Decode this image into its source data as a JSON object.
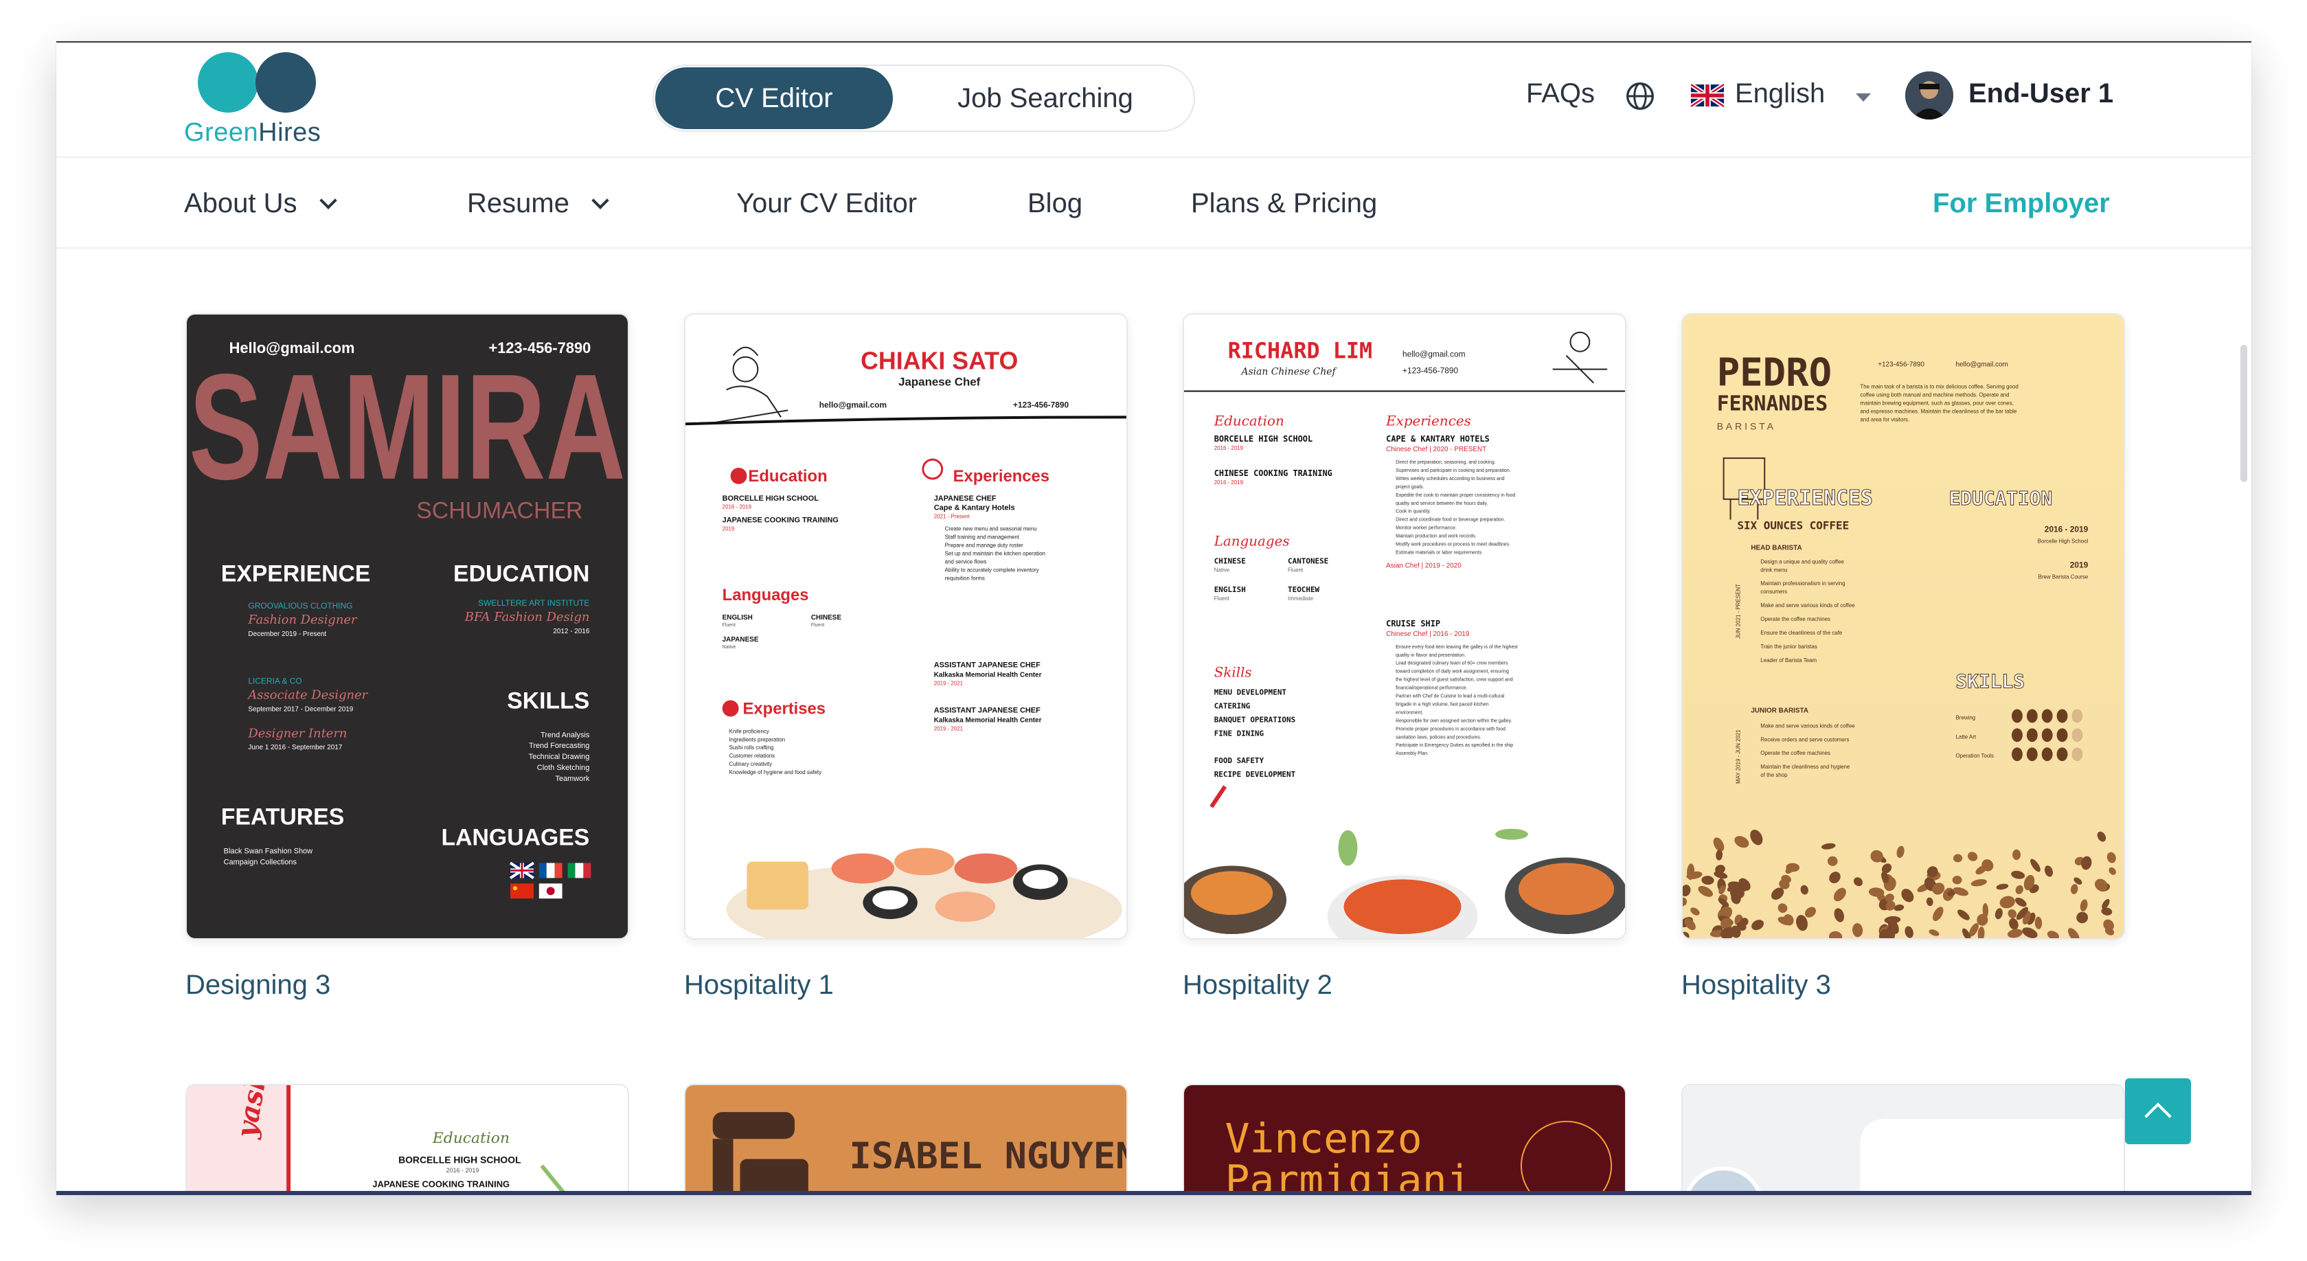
{
  "brand": {
    "part1": "Green",
    "part2": "Hires"
  },
  "header": {
    "modes": [
      "CV Editor",
      "Job Searching"
    ],
    "faq": "FAQs",
    "language": "English",
    "user": "End-User 1"
  },
  "nav": [
    "About Us",
    "Resume",
    "Your CV Editor",
    "Blog",
    "Plans & Pricing",
    "For Employer"
  ],
  "colors": {
    "teal": "#20aeb5",
    "navy": "#28536b",
    "red": "#d7262f"
  },
  "templates": [
    {
      "caption": "Designing 3",
      "email": "Hello@gmail.com",
      "phone": "+123-456-7890",
      "name": "SAMIRA",
      "surname": "SCHUMACHER",
      "h_experience": "EXPERIENCE",
      "h_education": "EDUCATION",
      "h_skills": "SKILLS",
      "h_features": "FEATURES",
      "h_languages": "LANGUAGES",
      "exp1": "GROOVALIOUS CLOTHING",
      "exp1_role": "Fashion Designer",
      "exp1_date": "December 2019 - Present",
      "exp2": "LICERIA & CO",
      "exp2_role": "Associate Designer",
      "exp2_date": "September 2017 - December 2019",
      "exp3_role": "Designer Intern",
      "exp3_date": "June 1 2016 - September 2017",
      "edu1": "SWELLTERE ART INSTITUTE",
      "edu1_deg": "BFA Fashion Design",
      "edu1_date": "2012 - 2016",
      "skills": [
        "Trend Analysis",
        "Trend Forecasting",
        "Technical Drawing",
        "Cloth Sketching",
        "Teamwork"
      ],
      "features": [
        "Black Swan Fashion Show",
        "Campaign Collections"
      ]
    },
    {
      "caption": "Hospitality 1",
      "name": "CHIAKI SATO",
      "title": "Japanese Chef",
      "email": "hello@gmail.com",
      "phone": "+123-456-7890",
      "h_education": "Education",
      "h_experiences": "Experiences",
      "h_languages": "Languages",
      "h_expertises": "Expertises",
      "edu1": "BORCELLE HIGH SCHOOL",
      "edu1_date": "2016 - 2019",
      "edu2": "JAPANESE COOKING TRAINING",
      "edu2_date": "2019",
      "exp_title": "JAPANESE CHEF",
      "exp_place": "Cape & Kantary Hotels",
      "exp_date": "2021 - Present",
      "exp_items": [
        "Create new menu and seasonal menu",
        "Staff training and management",
        "Prepare and manage duty roster",
        "Set up and maintain the kitchen operation",
        "and service flows",
        "Ability to accurately complete inventory",
        "requisition forms"
      ],
      "langs": [
        "ENGLISH",
        "CHINESE",
        "JAPANESE"
      ],
      "lang_levels": [
        "Fluent",
        "Fluent",
        "Native"
      ],
      "exp2_title": "ASSISTANT JAPANESE CHEF",
      "exp2_place": "Kalkaska Memorial Health Center",
      "exp2_date": "2019 - 2021",
      "exp3_title": "ASSISTANT JAPANESE CHEF",
      "exp3_place": "Kalkaska Memorial Health Center",
      "exp3_date": "2019 - 2021",
      "expertises": [
        "Knife proficiency",
        "Ingredients preparation",
        "Sushi rolls crafting",
        "Customer relations",
        "Culinary creativity",
        "Knowledge of hygiene and food safety"
      ]
    },
    {
      "caption": "Hospitality 2",
      "name": "RICHARD LIM",
      "title": "Asian Chinese Chef",
      "email": "hello@gmail.com",
      "phone": "+123-456-7890",
      "h_education": "Education",
      "h_experiences": "Experiences",
      "h_languages": "Languages",
      "h_skills": "Skills",
      "edu1": "BORCELLE HIGH SCHOOL",
      "edu1_date": "2016 - 2019",
      "edu2": "CHINESE COOKING TRAINING",
      "edu2_date": "2016 - 2019",
      "exp1": "CAPE & KANTARY HOTELS",
      "exp1_role": "Chinese Chef  |  2020 - PRESENT",
      "exp1_items": [
        "Direct the preparation, seasoning, and cooking.",
        "Supervises and participate in cooking and preparation.",
        "Writes weekly schedules according to business and",
        "project goals.",
        "Expedite the cook to maintain proper consistency in food",
        "quality and service between the hours daily.",
        "Cook in quantity.",
        "Direct and coordinate food or beverage preparation.",
        "Monitor worker performance.",
        "Maintain production and work records.",
        "Modify work procedures or process to meet deadlines.",
        "Estimate materials or labor requirements."
      ],
      "exp1_role2": "Asian Chef  |  2019 - 2020",
      "langs": [
        "CHINESE",
        "CANTONESE",
        "ENGLISH",
        "TEOCHEW"
      ],
      "lang_levels": [
        "Native",
        "Fluent",
        "Fluent",
        "Immediate"
      ],
      "exp2": "CRUISE SHIP",
      "exp2_role": "Chinese Chef  |  2016 - 2019",
      "exp2_items": [
        "Ensure every food item leaving the galley is of the highest",
        "quality in flavor and presentation.",
        "Lead designated culinary team of 60+ crew members",
        "toward completion of daily work assignment, ensuring",
        "the highest level of guest satisfaction, crew support and",
        "financial/operational performance.",
        "Partner with Chef de Cuisine to lead a multi-cultural",
        "brigade in a high volume, fast paced kitchen",
        "environment.",
        "Responsible for own assigned section within the galley.",
        "Promote proper procedures in accordance with food",
        "sanitation laws, policies and procedures.",
        "Participate in Emergency Duties as specified in the ship",
        "Assembly Plan."
      ],
      "skills": [
        "MENU DEVELOPMENT",
        "CATERING",
        "BANQUET OPERATIONS",
        "FINE DINING",
        "FOOD SAFETY",
        "RECIPE DEVELOPMENT"
      ]
    },
    {
      "caption": "Hospitality 3",
      "first": "PEDRO",
      "last": "FERNANDES",
      "title": "BARISTA",
      "phone": "+123-456-7890",
      "email": "hello@gmail.com",
      "summary": [
        "The main task of a barista is to mix delicious coffee. Serving good",
        "coffee using both manual and machine methods. Operate and",
        "maintain brewing equipment, such as glasses, pour over cones,",
        "and espresso machines. Maintain the cleanliness of the bar table",
        "and area for visitors."
      ],
      "h_experiences": "EXPERIENCES",
      "h_education": "EDUCATION",
      "h_skills": "SKILLS",
      "company": "SIX OUNCES COFFEE",
      "role1": "HEAD BARISTA",
      "role1_date": "JUN 2021 - PRESENT",
      "role1_items": [
        "Design a unique and quality coffee",
        "drink menu",
        "Maintain professionalism in serving",
        "consumers",
        "Make and serve various kinds of coffee",
        "Operate the coffee machines",
        "Ensure the cleanliness of the cafe",
        "Train the junior baristas",
        "Leader of Barista Team"
      ],
      "role2": "JUNIOR BARISTA",
      "role2_date": "MAY 2019 - JUN 2021",
      "role2_items": [
        "Make and serve various kinds of coffee",
        "Receive orders and serve customers",
        "Operate the coffee machines",
        "Maintain the cleanliness and hygiene",
        "of the shop"
      ],
      "edu1_date": "2016 - 2019",
      "edu1": "Borcelle High School",
      "edu2_date": "2019",
      "edu2": "Brew Barista Course",
      "skills": [
        "Brewing",
        "Latte Art",
        "Operation Tools"
      ],
      "skill_levels": [
        0.8,
        0.8,
        0.8
      ]
    }
  ],
  "row2": [
    {
      "edu_heading": "Education",
      "edu1": "BORCELLE HIGH SCHOOL",
      "edu1_date": "2016 - 2019",
      "edu2": "JAPANESE COOKING TRAINING",
      "edu2_date": "2019",
      "script": "yashi"
    },
    {
      "name": "ISABEL NGUYEN"
    },
    {
      "name_line1": "Vincenzo",
      "name_line2": "Parmigiani"
    },
    {}
  ]
}
